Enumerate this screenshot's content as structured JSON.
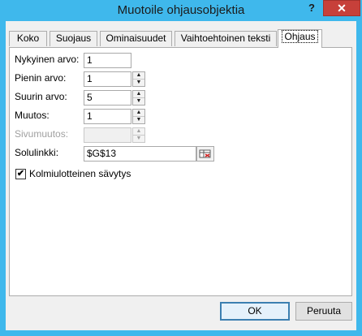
{
  "window": {
    "title": "Muotoile ohjausobjektia",
    "help_label": "?",
    "close_label": "✕"
  },
  "tabs": [
    {
      "label": "Koko"
    },
    {
      "label": "Suojaus"
    },
    {
      "label": "Ominaisuudet"
    },
    {
      "label": "Vaihtoehtoinen teksti"
    },
    {
      "label": "Ohjaus",
      "active": true
    }
  ],
  "form": {
    "current_value": {
      "label": "Nykyinen arvo:",
      "value": "1"
    },
    "min_value": {
      "label": "Pienin arvo:",
      "value": "1"
    },
    "max_value": {
      "label": "Suurin arvo:",
      "value": "5"
    },
    "increment": {
      "label": "Muutos:",
      "value": "1"
    },
    "page_change": {
      "label": "Sivumuutos:",
      "value": ""
    },
    "cell_link": {
      "label": "Solulinkki:",
      "value": "$G$13"
    },
    "shading_3d": {
      "label": "Kolmiulotteinen sävytys",
      "checked": true
    }
  },
  "buttons": {
    "ok": "OK",
    "cancel": "Peruuta"
  },
  "colors": {
    "titlebar": "#3fb8ec",
    "close_button": "#c7403a",
    "dialog_bg": "#f0f0f0"
  }
}
